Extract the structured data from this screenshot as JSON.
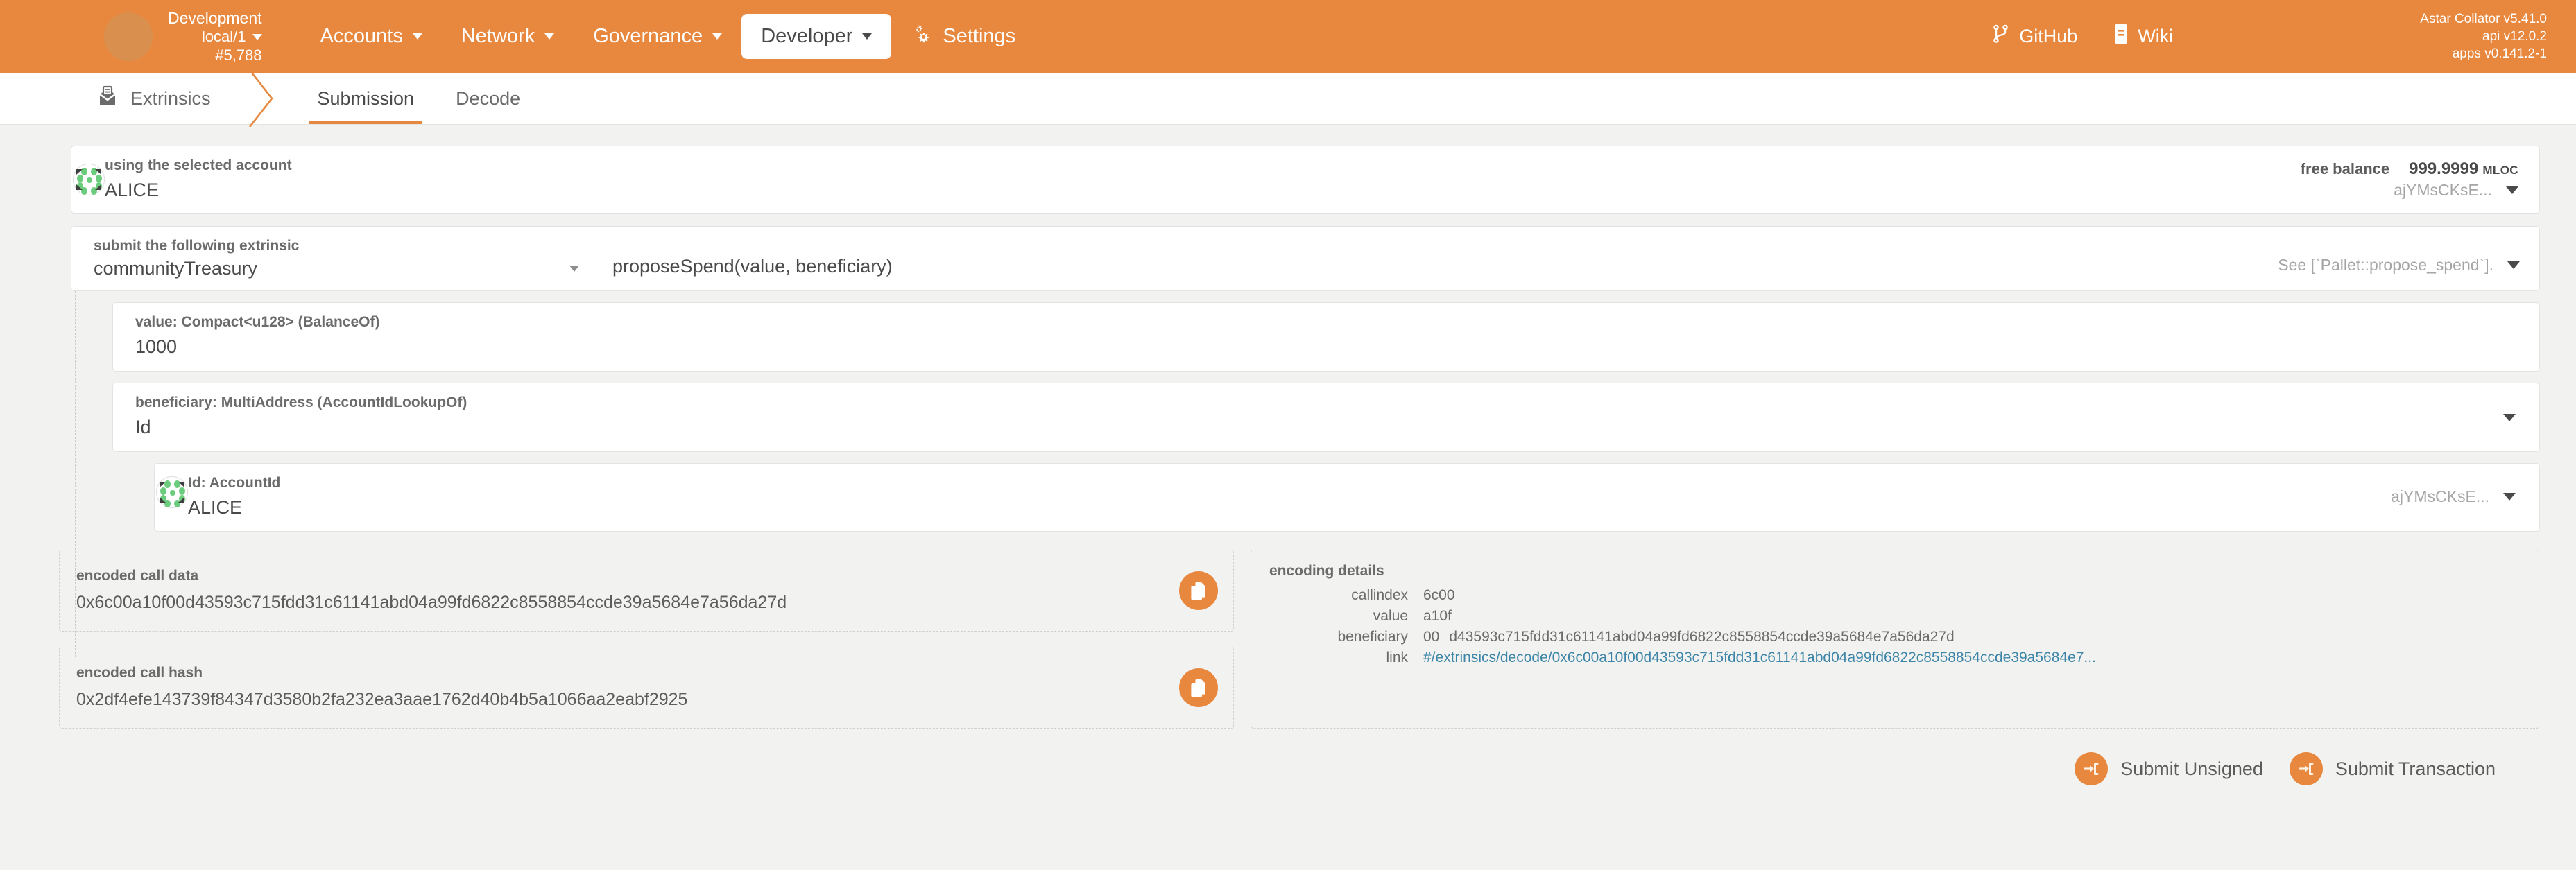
{
  "topbar": {
    "chain": {
      "name": "Development",
      "endpoint": "local/1",
      "block": "#5,788"
    },
    "nav": [
      {
        "label": "Accounts",
        "active": false
      },
      {
        "label": "Network",
        "active": false
      },
      {
        "label": "Governance",
        "active": false
      },
      {
        "label": "Developer",
        "active": true
      },
      {
        "label": "Settings",
        "active": false,
        "icon": "gears-icon"
      }
    ],
    "links": [
      {
        "label": "GitHub",
        "icon": "github-icon"
      },
      {
        "label": "Wiki",
        "icon": "book-icon"
      }
    ],
    "versions": {
      "node": "Astar Collator v5.41.0",
      "api": "api v12.0.2",
      "apps": "apps v0.141.2-1"
    },
    "accent": "#e8883f"
  },
  "tabbar": {
    "section": "Extrinsics",
    "section_icon": "envelope-icon",
    "tabs": [
      {
        "label": "Submission",
        "active": true
      },
      {
        "label": "Decode",
        "active": false
      }
    ]
  },
  "account": {
    "label": "using the selected account",
    "value": "ALICE",
    "balance_label": "free balance",
    "balance_amount": "999.9999",
    "balance_unit": "MLOC",
    "address_short": "ajYMsCKsE..."
  },
  "extrinsic": {
    "label": "submit the following extrinsic",
    "pallet": "communityTreasury",
    "method": "proposeSpend(value, beneficiary)",
    "docs": "See [`Pallet::propose_spend`]."
  },
  "params": [
    {
      "label": "value: Compact<u128> (BalanceOf)",
      "value": "1000"
    },
    {
      "label": "beneficiary: MultiAddress (AccountIdLookupOf)",
      "value": "Id"
    }
  ],
  "nested_param": {
    "label": "Id: AccountId",
    "value": "ALICE",
    "address_short": "ajYMsCKsE..."
  },
  "encoded": {
    "call_data_label": "encoded call data",
    "call_data": "0x6c00a10f00d43593c715fdd31c61141abd04a99fd6822c8558854ccde39a5684e7a56da27d",
    "call_hash_label": "encoded call hash",
    "call_hash": "0x2df4efe143739f84347d3580b2fa232ea3aae1762d40b4b5a1066aa2eabf2925",
    "copy_icon": "copy-icon"
  },
  "encoding_details": {
    "title": "encoding details",
    "rows": [
      {
        "key": "callindex",
        "value": "6c00",
        "link": false
      },
      {
        "key": "value",
        "value": "a10f",
        "link": false
      },
      {
        "key": "beneficiary",
        "prefix": "00",
        "value": "d43593c715fdd31c61141abd04a99fd6822c8558854ccde39a5684e7a56da27d",
        "link": false
      },
      {
        "key": "link",
        "value": "#/extrinsics/decode/0x6c00a10f00d43593c715fdd31c61141abd04a99fd6822c8558854ccde39a5684e7...",
        "link": true
      }
    ],
    "link_color": "#3c85a8"
  },
  "footer": {
    "buttons": [
      {
        "label": "Submit Unsigned",
        "icon": "sign-in-icon"
      },
      {
        "label": "Submit Transaction",
        "icon": "sign-in-icon"
      }
    ]
  }
}
